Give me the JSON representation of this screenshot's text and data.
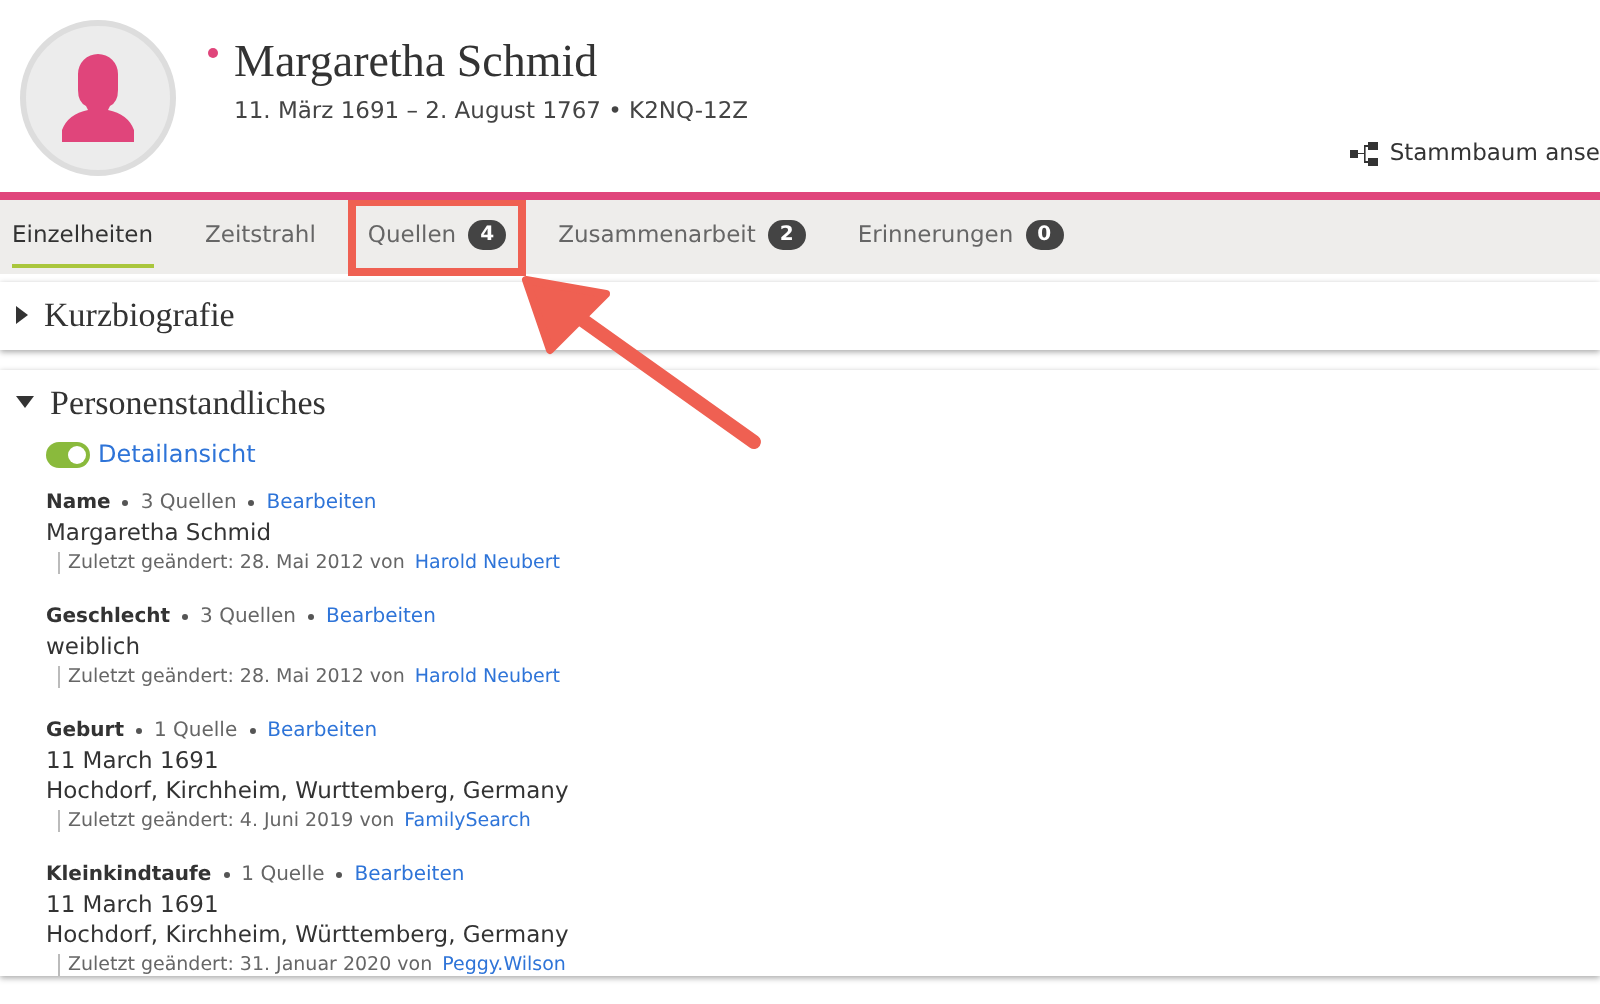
{
  "person": {
    "name": "Margaretha Schmid",
    "life": "11. März 1691 – 2. August 1767 • K2NQ-12Z",
    "female": true
  },
  "tree_link": "Stammbaum anse",
  "tabs": [
    {
      "label": "Einzelheiten",
      "selected": true,
      "highlighted": false
    },
    {
      "label": "Zeitstrahl",
      "selected": false,
      "highlighted": false
    },
    {
      "label": "Quellen",
      "count": "4",
      "selected": false,
      "highlighted": true
    },
    {
      "label": "Zusammenarbeit",
      "count": "2",
      "selected": false,
      "highlighted": false
    },
    {
      "label": "Erinnerungen",
      "count": "0",
      "selected": false,
      "highlighted": false
    }
  ],
  "sections": [
    {
      "title": "Kurzbiografie",
      "expanded": false
    },
    {
      "title": "Personenstandliches",
      "expanded": true,
      "toggle": {
        "label": "Detailansicht",
        "on": true
      },
      "facts": [
        {
          "label": "Name",
          "sources": "3 Quellen",
          "edit": "Bearbeiten",
          "values": [
            "Margaretha Schmid"
          ],
          "changed": "Zuletzt geändert: 28. Mai 2012 von",
          "by": "Harold Neubert"
        },
        {
          "label": "Geschlecht",
          "sources": "3 Quellen",
          "edit": "Bearbeiten",
          "values": [
            "weiblich"
          ],
          "changed": "Zuletzt geändert: 28. Mai 2012 von",
          "by": "Harold Neubert"
        },
        {
          "label": "Geburt",
          "sources": "1 Quelle",
          "edit": "Bearbeiten",
          "values": [
            "11 March 1691",
            "Hochdorf, Kirchheim, Wurttemberg, Germany"
          ],
          "changed": "Zuletzt geändert: 4. Juni 2019 von",
          "by": "FamilySearch"
        },
        {
          "label": "Kleinkindtaufe",
          "sources": "1 Quelle",
          "edit": "Bearbeiten",
          "values": [
            "11 March 1691",
            "Hochdorf, Kirchheim, Württemberg, Germany"
          ],
          "changed": "Zuletzt geändert: 31. Januar 2020 von",
          "by": "Peggy.Wilson"
        }
      ]
    }
  ]
}
